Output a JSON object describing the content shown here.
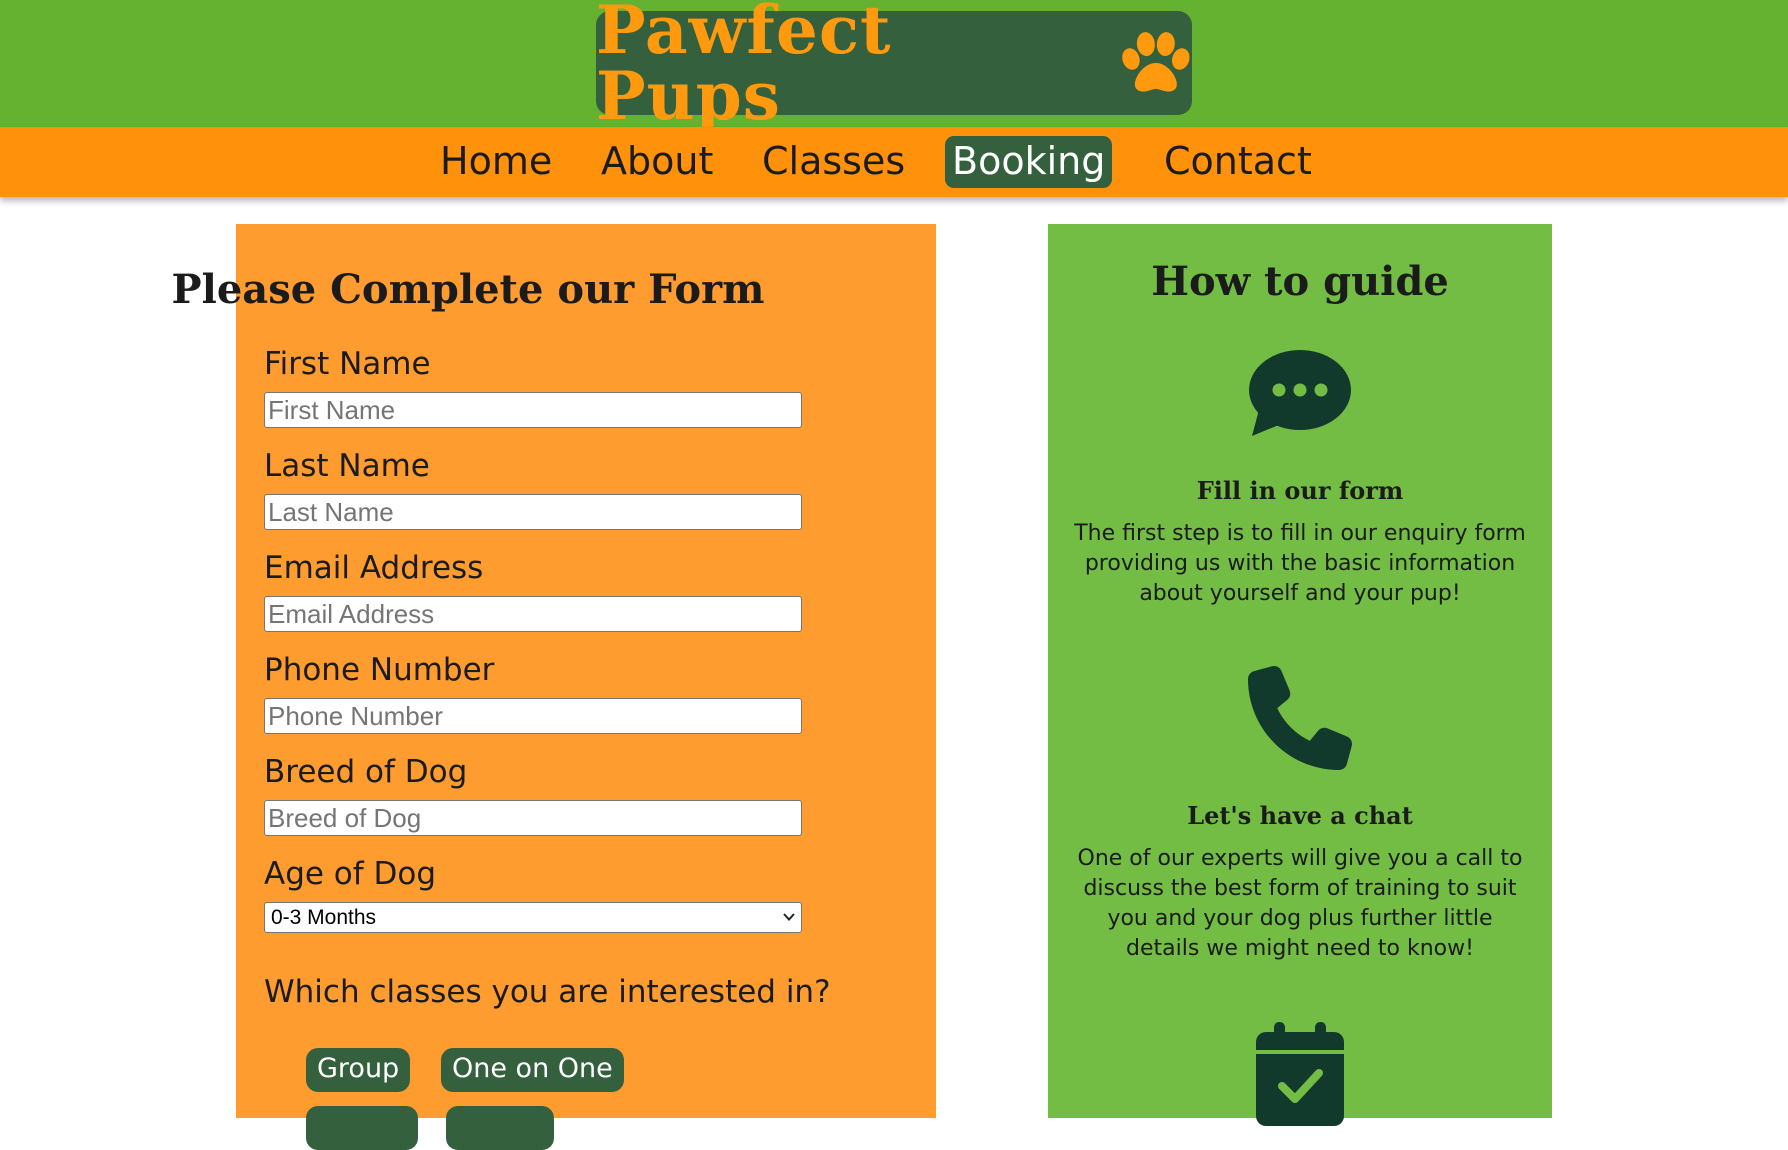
{
  "site": {
    "logo_text": "Pawfect Pups",
    "logo_icon": "paw-icon",
    "colors": {
      "header_green": "#64b22f",
      "logo_box": "#35603d",
      "brand_orange": "#ff9a0f",
      "nav_orange": "#ff920a",
      "form_panel": "#ff9c30",
      "guide_panel": "#73bd45"
    }
  },
  "nav": {
    "items": [
      {
        "label": "Home"
      },
      {
        "label": "About"
      },
      {
        "label": "Classes"
      },
      {
        "label": "Booking",
        "active": true
      },
      {
        "label": "Contact"
      }
    ]
  },
  "form": {
    "title": "Please Complete our Form",
    "fields": [
      {
        "label": "First Name",
        "placeholder": "First Name",
        "value": ""
      },
      {
        "label": "Last Name",
        "placeholder": "Last Name",
        "value": ""
      },
      {
        "label": "Email Address",
        "placeholder": "Email Address",
        "value": ""
      },
      {
        "label": "Phone Number",
        "placeholder": "Phone Number",
        "value": ""
      },
      {
        "label": "Breed of Dog",
        "placeholder": "Breed of Dog",
        "value": ""
      }
    ],
    "age": {
      "label": "Age of Dog",
      "selected": "0-3 Months",
      "icon": "chevron-down-icon"
    },
    "classes_question": "Which classes you are interested in?",
    "class_options": [
      "Group",
      "One on One"
    ]
  },
  "guide": {
    "title": "How to guide",
    "steps": [
      {
        "icon": "speech-bubble-icon",
        "heading": "Fill in our form",
        "text": "The first step is to fill in our enquiry form providing us with the basic information about yourself and your pup!"
      },
      {
        "icon": "phone-icon",
        "heading": "Let's have a chat",
        "text": "One of our experts will give you a call to discuss the best form of training to suit you and your dog plus further little details we might need to know!"
      },
      {
        "icon": "calendar-check-icon"
      }
    ]
  }
}
